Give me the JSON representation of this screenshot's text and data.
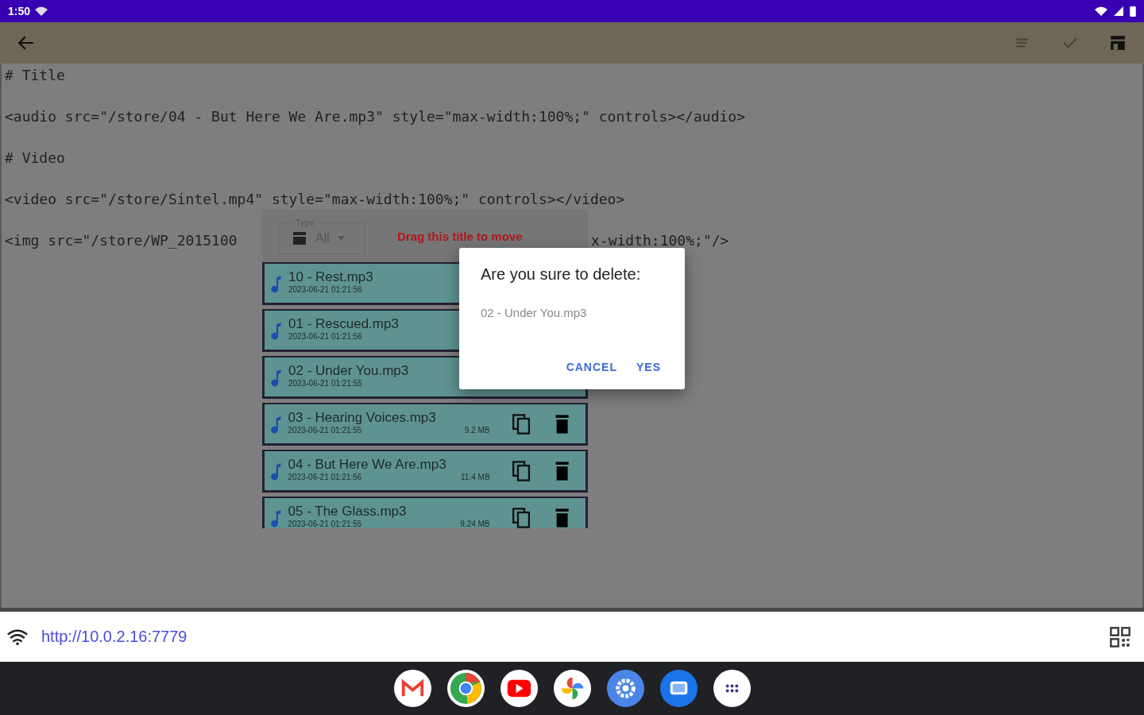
{
  "status_bar": {
    "time": "1:50"
  },
  "editor": {
    "lines": [
      "# Title",
      "<audio src=\"/store/04 - But Here We Are.mp3\" style=\"max-width:100%;\" controls></audio>",
      "# Video",
      "<video src=\"/store/Sintel.mp4\" style=\"max-width:100%;\" controls></video>"
    ],
    "covered_line": [
      "<img src=\"/store/WP_2015100",
      "x-width:100%;\"/>"
    ]
  },
  "file_panel": {
    "type_label": "Type",
    "type_value": "All",
    "drag_hint": "Drag this title to move",
    "files": [
      {
        "name": "10 - Rest.mp3",
        "date": "2023-06-21 01:21:56"
      },
      {
        "name": "01 - Rescued.mp3",
        "date": "2023-06-21 01:21:56"
      },
      {
        "name": "02 - Under You.mp3",
        "date": "2023-06-21 01:21:55"
      },
      {
        "name": "03 - Hearing Voices.mp3",
        "date": "2023-06-21 01:21:55",
        "size": "9.2 MB"
      },
      {
        "name": "04 - But Here We Are.mp3",
        "date": "2023-06-21 01:21:56",
        "size": "11.4 MB"
      },
      {
        "name": "05 - The Glass.mp3",
        "date": "2023-06-21 01:21:55",
        "size": "9.24 MB"
      }
    ]
  },
  "dialog": {
    "title": "Are you sure to delete:",
    "message": "02 - Under You.mp3",
    "buttons": [
      "CANCEL",
      "YES"
    ]
  },
  "server_bar": {
    "url": "http://10.0.2.16:7779"
  },
  "dock": {
    "apps": [
      {
        "kind": "mail"
      },
      {
        "kind": "browser"
      },
      {
        "kind": "video"
      },
      {
        "kind": "photos"
      },
      {
        "kind": "settings"
      },
      {
        "kind": "messages"
      },
      {
        "kind": "apps"
      }
    ]
  }
}
